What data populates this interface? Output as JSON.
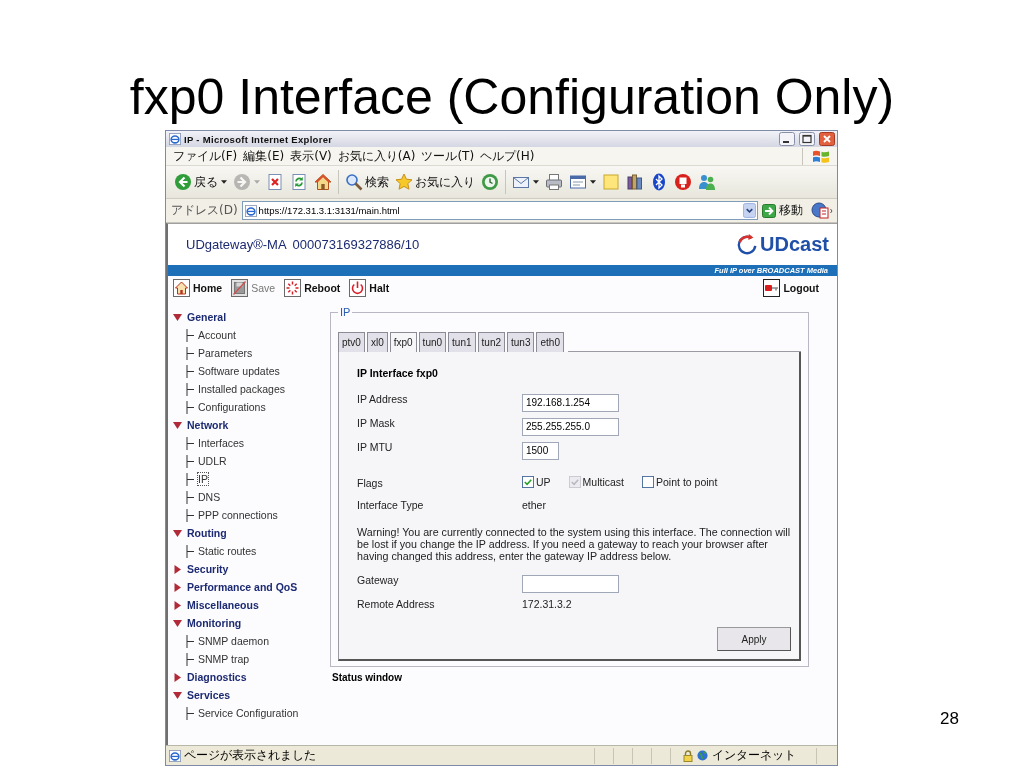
{
  "slide": {
    "title": "fxp0 Interface (Configuration Only)",
    "page_number": "28"
  },
  "window": {
    "title": "IP - Microsoft Internet Explorer"
  },
  "menu": [
    "ファイル(F)",
    "編集(E)",
    "表示(V)",
    "お気に入り(A)",
    "ツール(T)",
    "ヘルプ(H)"
  ],
  "toolbar": [
    {
      "kind": "back",
      "label": "戻る",
      "dropdown": true,
      "disabled": false
    },
    {
      "kind": "forward",
      "dropdown": true,
      "disabled": true
    },
    {
      "kind": "stop",
      "dropdown": false,
      "disabled": false
    },
    {
      "kind": "refresh",
      "dropdown": false,
      "disabled": false
    },
    {
      "kind": "home",
      "dropdown": false,
      "disabled": false
    },
    {
      "kind": "separator"
    },
    {
      "kind": "search",
      "label": "検索",
      "dropdown": false,
      "disabled": false
    },
    {
      "kind": "favorites",
      "label": "お気に入り",
      "dropdown": false,
      "disabled": false
    },
    {
      "kind": "history",
      "dropdown": false,
      "disabled": false
    },
    {
      "kind": "separator"
    },
    {
      "kind": "mail",
      "dropdown": true,
      "disabled": false
    },
    {
      "kind": "print",
      "dropdown": false,
      "disabled": false
    },
    {
      "kind": "edit",
      "dropdown": true,
      "disabled": false
    },
    {
      "kind": "note",
      "dropdown": false,
      "disabled": false
    },
    {
      "kind": "research",
      "dropdown": false,
      "disabled": false
    },
    {
      "kind": "bluetooth",
      "dropdown": false,
      "disabled": false
    },
    {
      "kind": "emblem",
      "dropdown": false,
      "disabled": false
    },
    {
      "kind": "messenger",
      "dropdown": false,
      "disabled": false
    }
  ],
  "address_bar": {
    "label": "アドレス(D)",
    "value": "https://172.31.3.1:3131/main.html",
    "go_label": "移動"
  },
  "page": {
    "product": "UDgateway®-MA",
    "serial": "000073169327886/10",
    "brand": "UDcast",
    "tagline": "Full IP over BROADCAST Media",
    "actions": [
      {
        "kind": "home",
        "label": "Home",
        "disabled": false
      },
      {
        "kind": "save",
        "label": "Save",
        "disabled": true
      },
      {
        "kind": "reboot",
        "label": "Reboot",
        "disabled": false
      },
      {
        "kind": "halt",
        "label": "Halt",
        "disabled": false
      }
    ],
    "logout": "Logout",
    "nav": [
      {
        "label": "General",
        "expanded": true,
        "selected": false,
        "children": [
          {
            "label": "Account",
            "selected": false
          },
          {
            "label": "Parameters",
            "selected": false
          },
          {
            "label": "Software updates",
            "selected": false
          },
          {
            "label": "Installed packages",
            "selected": false
          },
          {
            "label": "Configurations",
            "selected": false
          }
        ]
      },
      {
        "label": "Network",
        "expanded": true,
        "selected": false,
        "children": [
          {
            "label": "Interfaces",
            "selected": false
          },
          {
            "label": "UDLR",
            "selected": false
          },
          {
            "label": "IP",
            "selected": true
          },
          {
            "label": "DNS",
            "selected": false
          },
          {
            "label": "PPP connections",
            "selected": false
          }
        ]
      },
      {
        "label": "Routing",
        "expanded": true,
        "selected": false,
        "children": [
          {
            "label": "Static routes",
            "selected": false
          }
        ]
      },
      {
        "label": "Security",
        "expanded": false,
        "selected": false
      },
      {
        "label": "Performance and QoS",
        "expanded": false,
        "selected": false
      },
      {
        "label": "Miscellaneous",
        "expanded": false,
        "selected": false
      },
      {
        "label": "Monitoring",
        "expanded": true,
        "selected": false,
        "children": [
          {
            "label": "SNMP daemon",
            "selected": false
          },
          {
            "label": "SNMP trap",
            "selected": false
          }
        ]
      },
      {
        "label": "Diagnostics",
        "expanded": false,
        "selected": false
      },
      {
        "label": "Services",
        "expanded": true,
        "selected": false,
        "children": [
          {
            "label": "Service Configuration",
            "selected": false
          }
        ]
      }
    ],
    "panel": {
      "legend": "IP",
      "tabs": [
        {
          "label": "ptv0",
          "selected": false
        },
        {
          "label": "xl0",
          "selected": false
        },
        {
          "label": "fxp0",
          "selected": true
        },
        {
          "label": "tun0",
          "selected": false
        },
        {
          "label": "tun1",
          "selected": false
        },
        {
          "label": "tun2",
          "selected": false
        },
        {
          "label": "tun3",
          "selected": false
        },
        {
          "label": "eth0",
          "selected": false
        }
      ],
      "heading": "IP Interface fxp0",
      "rows": [
        {
          "kind": "input",
          "label": "IP Address",
          "value": "192.168.1.254"
        },
        {
          "kind": "input",
          "label": "IP Mask",
          "value": "255.255.255.0"
        },
        {
          "kind": "short_input",
          "label": "IP MTU",
          "value": "1500"
        },
        {
          "kind": "flags",
          "label": "Flags",
          "options": [
            {
              "label": "UP",
              "checked": true,
              "disabled": false
            },
            {
              "label": "Multicast",
              "checked": true,
              "disabled": true
            },
            {
              "label": "Point to point",
              "checked": false,
              "disabled": false
            }
          ]
        },
        {
          "kind": "text",
          "label": "Interface Type",
          "value": "ether"
        },
        {
          "kind": "note",
          "text": "Warning! You are currently connected to the system using this interface. The connection will be lost if you change the IP address. If you need a gateway to reach your browser after having changed this address, enter the gateway IP address below."
        },
        {
          "kind": "input",
          "label": "Gateway"
        },
        {
          "kind": "text",
          "label": "Remote Address",
          "value": "172.31.3.2"
        }
      ],
      "apply": "Apply"
    },
    "status_window": "Status window"
  },
  "status_bar": {
    "text": "ページが表示されました",
    "zone": "インターネット"
  }
}
